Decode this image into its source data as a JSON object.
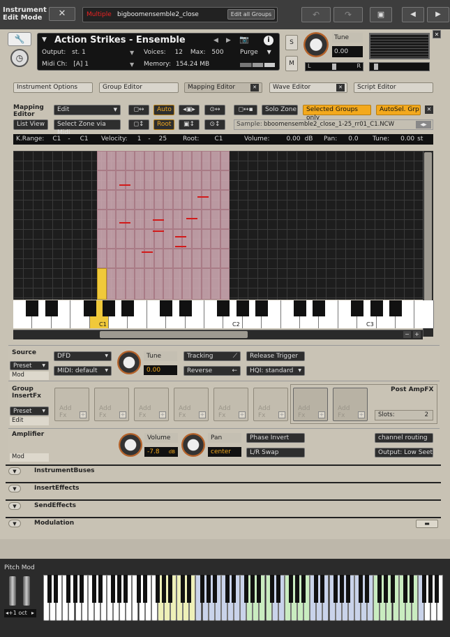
{
  "topbar": {
    "title_line1": "Instrument",
    "title_line2": "Edit Mode",
    "multiple_label": "Multiple",
    "instrument_name": "bigboomensemble2_close",
    "edit_all_groups": "Edit all Groups"
  },
  "header": {
    "instrument_title": "Action Strikes - Ensemble",
    "output_label": "Output:",
    "output_value": "st. 1",
    "voices_label": "Voices:",
    "voices_value": "12",
    "max_label": "Max:",
    "max_value": "500",
    "purge_label": "Purge",
    "midi_label": "Midi Ch:",
    "midi_value": "[A] 1",
    "memory_label": "Memory:",
    "memory_value": "154.24 MB",
    "s_label": "S",
    "m_label": "M",
    "tune_label": "Tune",
    "tune_value": "0.00",
    "pan_l": "L",
    "pan_r": "R"
  },
  "editor_tabs": [
    "Instrument Options",
    "Group Editor",
    "Mapping Editor",
    "Wave Editor",
    "Script Editor"
  ],
  "mapping": {
    "title1": "Mapping",
    "title2": "Editor",
    "edit_menu": "Edit",
    "auto": "Auto",
    "root": "Root",
    "list_view": "List View",
    "select_zone_via_midi": "Select Zone via Midi",
    "solo_zone": "Solo Zone",
    "selected_groups_only": "Selected Groups only",
    "autosel_grp": "AutoSel. Grp",
    "sample_label": "Sample:",
    "sample_value": "bboomensemble2_close_1-25_rr01_C1.NCW"
  },
  "zoneinfo": {
    "krange_label": "K.Range:",
    "krange_lo": "C1",
    "krange_dash": "-",
    "krange_hi": "C1",
    "vel_label": "Velocity:",
    "vel_lo": "1",
    "vel_dash": "-",
    "vel_hi": "25",
    "root_label": "Root:",
    "root_value": "C1",
    "volume_label": "Volume:",
    "volume_value": "0.00",
    "volume_unit": "dB",
    "pan_label": "Pan:",
    "pan_value": "0.0",
    "tune_label": "Tune:",
    "tune_value": "0.00",
    "tune_unit": "st"
  },
  "keyboard_labels": {
    "c1": "C1",
    "c2": "C2",
    "c3": "C3"
  },
  "source": {
    "title": "Source",
    "preset": "Preset",
    "mod": "Mod",
    "dfd": "DFD",
    "midi_default": "MIDI: default",
    "tune_label": "Tune",
    "tune_value": "0.00",
    "tracking": "Tracking",
    "reverse": "Reverse",
    "release_trigger": "Release Trigger",
    "hqi": "HQI: standard"
  },
  "insertfx": {
    "title1": "Group",
    "title2": "InsertFx",
    "preset": "Preset",
    "edit": "Edit",
    "add_fx": "Add",
    "fx": "Fx",
    "postampfx": "Post AmpFX",
    "slots_label": "Slots:",
    "slots_value": "2"
  },
  "amplifier": {
    "title": "Amplifier",
    "mod": "Mod",
    "volume_label": "Volume",
    "volume_value": "-7.8",
    "volume_unit": "dB",
    "pan_label": "Pan",
    "pan_value": "center",
    "phase_invert": "Phase Invert",
    "lr_swap": "L/R Swap",
    "channel_routing": "channel routing",
    "output": "Output: Low Seeth"
  },
  "sections": [
    "InstrumentBuses",
    "InsertEffects",
    "SendEffects",
    "Modulation"
  ],
  "bottom": {
    "pitch_mod": "Pitch Mod",
    "octave": "+1 oct"
  },
  "colors": {
    "accent_orange": "#f3a91d",
    "zone_pink": "#d6afb8",
    "selected_zone": "#f0c93a"
  }
}
